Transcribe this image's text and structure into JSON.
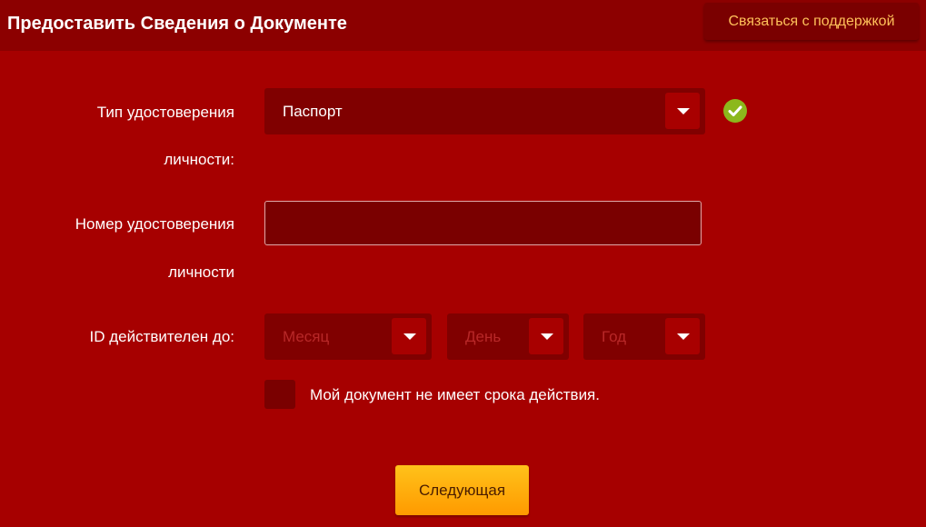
{
  "header": {
    "title": "Предоставить Сведения о Документе",
    "support_button": "Связаться с поддержкой"
  },
  "form": {
    "id_type": {
      "label_line1": "Тип удостоверения",
      "label_line2": "личности:",
      "value": "Паспорт",
      "valid_icon": "check-circle-icon"
    },
    "id_number": {
      "label_line1": "Номер удостоверения",
      "label_line2": "личности",
      "value": ""
    },
    "expiry": {
      "label": "ID действителен до:",
      "month_placeholder": "Месяц",
      "day_placeholder": "День",
      "year_placeholder": "Год"
    },
    "no_expiry_checkbox": {
      "label": "Мой документ не имеет срока действия.",
      "checked": false
    },
    "next_button": "Следующая"
  },
  "colors": {
    "background": "#a60000",
    "header": "#8c0000",
    "field": "#800000",
    "accent_text": "#ffc15a",
    "button_gradient_top": "#ffc21a",
    "button_gradient_bottom": "#ff9a00",
    "valid_green": "#8cb81c"
  }
}
